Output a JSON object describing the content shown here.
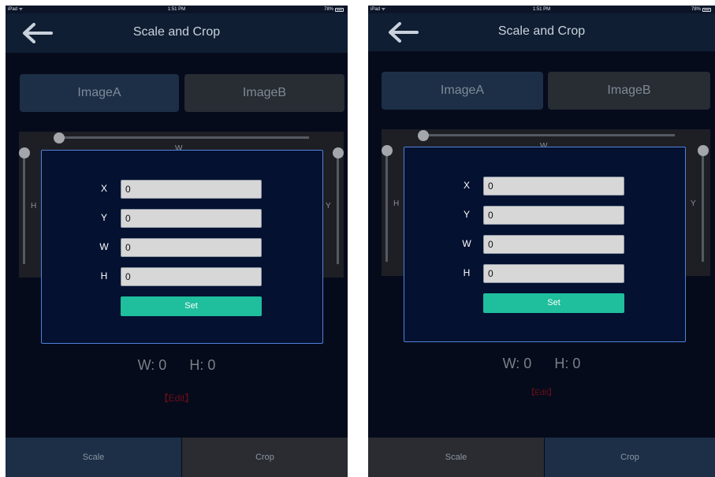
{
  "status_bar": {
    "carrier": "iPad ᯤ",
    "time": "1:51 PM",
    "battery": "78%"
  },
  "nav": {
    "title": "Scale and Crop",
    "back_icon": "back-arrow-icon"
  },
  "segments": {
    "a": "ImageA",
    "b": "ImageB"
  },
  "axis_labels": {
    "w": "W",
    "h": "H",
    "y": "Y"
  },
  "dialog": {
    "fields": [
      {
        "label": "X",
        "value": "0"
      },
      {
        "label": "Y",
        "value": "0"
      },
      {
        "label": "W",
        "value": "0"
      },
      {
        "label": "H",
        "value": "0"
      }
    ],
    "set_label": "Set"
  },
  "dims": {
    "w": "W: 0",
    "h": "H: 0"
  },
  "edit_label": "【Edit】",
  "tabs": {
    "scale": "Scale",
    "crop": "Crop"
  },
  "screens": {
    "left_selected_tab": "scale",
    "right_selected_tab": "crop"
  },
  "colors": {
    "accent_green": "#1fbe9d",
    "dialog_border": "#4f82d8",
    "selected_tab": "#1c2f47",
    "edit_red": "#6d0d15"
  }
}
